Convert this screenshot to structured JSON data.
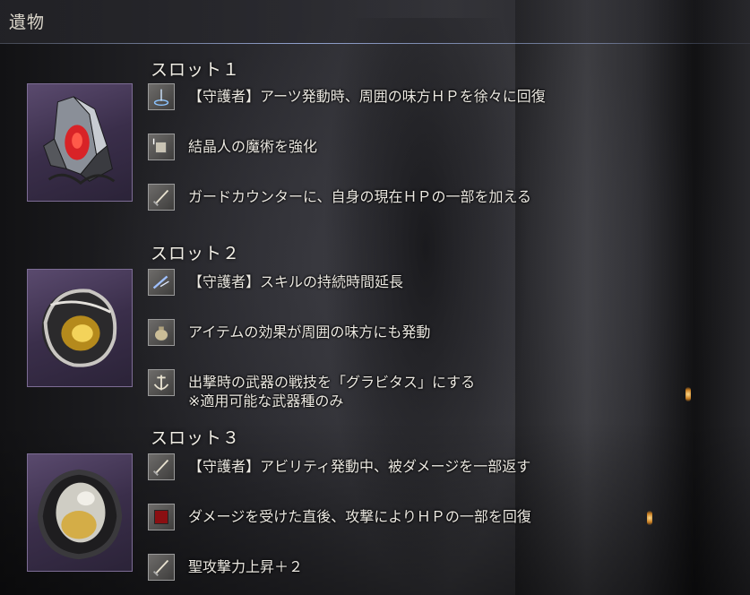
{
  "header": {
    "title": "遺物"
  },
  "slots": [
    {
      "heading": "スロット１",
      "relic_icon": "red-crystal-relic-icon",
      "effects": [
        {
          "icon": "guardian-ripple-icon",
          "line1": "【守護者】アーツ発動時、周囲の味方ＨＰを徐々に回復",
          "line2": ""
        },
        {
          "icon": "crystal-sorcery-icon",
          "line1": "結晶人の魔術を強化",
          "line2": ""
        },
        {
          "icon": "sword-icon",
          "line1": "ガードカウンターに、自身の現在ＨＰの一部を加える",
          "line2": ""
        }
      ]
    },
    {
      "heading": "スロット２",
      "relic_icon": "yellow-orb-relic-icon",
      "effects": [
        {
          "icon": "skill-blade-icon",
          "line1": "【守護者】スキルの持続時間延長",
          "line2": ""
        },
        {
          "icon": "item-pouch-icon",
          "line1": "アイテムの効果が周囲の味方にも発動",
          "line2": ""
        },
        {
          "icon": "anchor-icon",
          "line1": "出撃時の武器の戦技を「グラビタス」にする",
          "line2": "※適用可能な武器種のみ"
        }
      ]
    },
    {
      "heading": "スロット３",
      "relic_icon": "pale-orb-relic-icon",
      "effects": [
        {
          "icon": "sword-icon",
          "line1": "【守護者】アビリティ発動中、被ダメージを一部返す",
          "line2": ""
        },
        {
          "icon": "red-square-icon",
          "line1": "ダメージを受けた直後、攻撃によりＨＰの一部を回復",
          "line2": ""
        },
        {
          "icon": "sword-icon",
          "line1": "聖攻撃力上昇＋２",
          "line2": ""
        }
      ]
    }
  ]
}
